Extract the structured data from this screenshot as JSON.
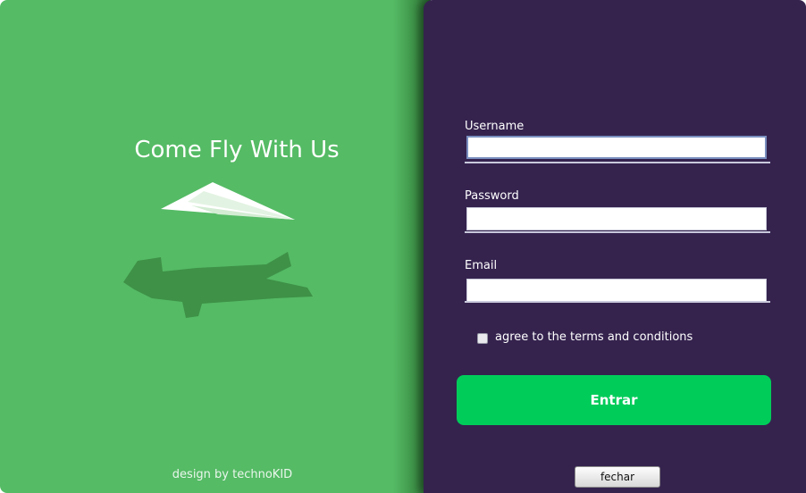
{
  "branding": {
    "tagline": "Come Fly With Us",
    "credit": "design by technoKID"
  },
  "form": {
    "username_label": "Username",
    "username_value": "",
    "password_label": "Password",
    "password_value": "",
    "email_label": "Email",
    "email_value": "",
    "terms_label": "agree to the terms and conditions",
    "terms_checked": false,
    "submit_label": "Entrar",
    "close_label": "fechar"
  },
  "colors": {
    "left_background": "#55bb65",
    "right_background": "#35234e",
    "submit_button": "#00cc5a"
  }
}
